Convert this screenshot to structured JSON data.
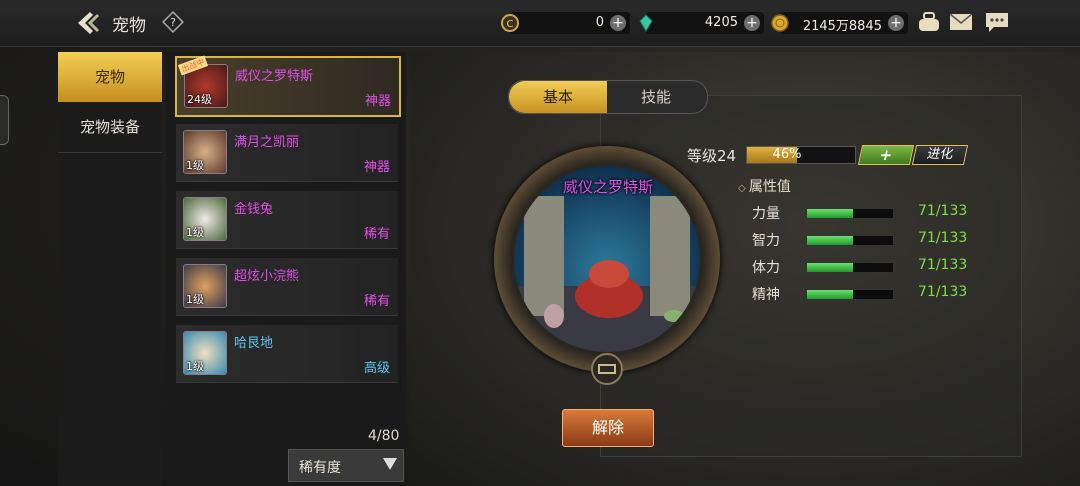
{
  "header": {
    "title": "宠物",
    "currencies": [
      {
        "icon": "gold-c-coin-icon",
        "value": "0"
      },
      {
        "icon": "green-crystal-icon",
        "value": "4205"
      },
      {
        "icon": "gold-coin-icon",
        "value": "2145万8845"
      }
    ],
    "icons": [
      "bag-icon",
      "mail-icon",
      "chat-icon"
    ]
  },
  "sidebar": {
    "tabs": [
      {
        "label": "宠物",
        "active": true
      },
      {
        "label": "宠物装备",
        "active": false
      }
    ]
  },
  "pet_list": {
    "items": [
      {
        "name": "威仪之罗特斯",
        "level": "24级",
        "rarity": "神器",
        "name_color": "#e04ee8",
        "selected": true,
        "badge": "出战中"
      },
      {
        "name": "满月之凯丽",
        "level": "1级",
        "rarity": "神器",
        "name_color": "#e04ee8",
        "selected": false
      },
      {
        "name": "金钱兔",
        "level": "1级",
        "rarity": "稀有",
        "name_color": "#e04ee8",
        "selected": false
      },
      {
        "name": "超炫小浣熊",
        "level": "1级",
        "rarity": "稀有",
        "name_color": "#e04ee8",
        "selected": false
      },
      {
        "name": "哈艮地",
        "level": "1级",
        "rarity": "高级",
        "name_color": "#5cc6f4",
        "selected": false
      }
    ],
    "count": "4/80",
    "sort": "稀有度"
  },
  "detail": {
    "tabs": {
      "basic": "基本",
      "skill": "技能"
    },
    "pet_name": "威仪之罗特斯",
    "level_label": "等级24",
    "xp_text": "46%",
    "xp_fraction": 0.46,
    "add_label": "+",
    "evolve_label": "进化",
    "attr_title": "属性值",
    "stats": [
      {
        "label": "力量",
        "value": "71/133",
        "fraction": 0.53
      },
      {
        "label": "智力",
        "value": "71/133",
        "fraction": 0.53
      },
      {
        "label": "体力",
        "value": "71/133",
        "fraction": 0.53
      },
      {
        "label": "精神",
        "value": "71/133",
        "fraction": 0.53
      }
    ],
    "release_label": "解除"
  }
}
